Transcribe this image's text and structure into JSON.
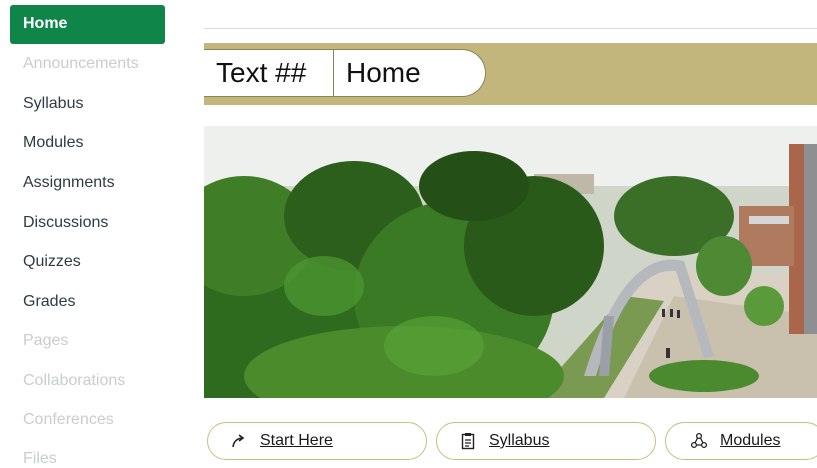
{
  "sidebar": {
    "items": [
      {
        "label": "Home",
        "state": "active"
      },
      {
        "label": "Announcements",
        "state": "disabled"
      },
      {
        "label": "Syllabus",
        "state": "enabled"
      },
      {
        "label": "Modules",
        "state": "enabled"
      },
      {
        "label": "Assignments",
        "state": "enabled"
      },
      {
        "label": "Discussions",
        "state": "enabled"
      },
      {
        "label": "Quizzes",
        "state": "enabled"
      },
      {
        "label": "Grades",
        "state": "enabled"
      },
      {
        "label": "Pages",
        "state": "disabled"
      },
      {
        "label": "Collaborations",
        "state": "disabled"
      },
      {
        "label": "Conferences",
        "state": "disabled"
      },
      {
        "label": "Files",
        "state": "disabled"
      }
    ],
    "active_color": "#10854a"
  },
  "banner": {
    "course_code": "Text ##",
    "page_title": "Home",
    "color": "#c3b67d"
  },
  "hero": {
    "icon": "campus-photo"
  },
  "buttons": {
    "start_here": {
      "label": "Start Here",
      "icon": "arrow-forward-icon"
    },
    "syllabus": {
      "label": "Syllabus",
      "icon": "clipboard-icon"
    },
    "modules": {
      "label": "Modules",
      "icon": "modules-icon"
    }
  }
}
